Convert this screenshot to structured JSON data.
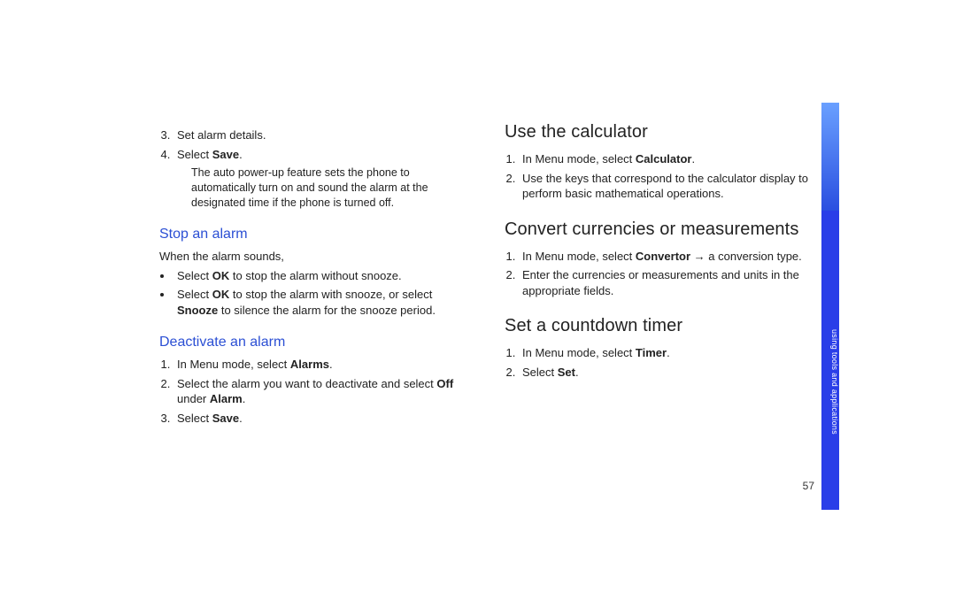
{
  "left": {
    "ol_top": {
      "start": 3,
      "i1_pre": "Set alarm details.",
      "i2_pre": "Select ",
      "i2_bold": "Save",
      "i2_post": "."
    },
    "note": "The auto power-up feature sets the phone to automatically turn on and sound the alarm at the designated time if the phone is turned off.",
    "h2a": "Stop an alarm",
    "para1": "When the alarm sounds,",
    "ul": {
      "i1_pre": "Select ",
      "i1_b1": "OK",
      "i1_post": " to stop the alarm without snooze.",
      "i2_pre": "Select ",
      "i2_b1": "OK",
      "i2_mid": " to stop the alarm with snooze, or select ",
      "i2_b2": "Snooze",
      "i2_post": " to silence the alarm for the snooze period."
    },
    "h2b": "Deactivate an alarm",
    "ol_b": {
      "i1_pre": "In Menu mode, select ",
      "i1_b": "Alarms",
      "i1_post": ".",
      "i2_pre": "Select the alarm you want to deactivate and select ",
      "i2_b1": "Off",
      "i2_mid": " under ",
      "i2_b2": "Alarm",
      "i2_post": ".",
      "i3_pre": "Select ",
      "i3_b": "Save",
      "i3_post": "."
    }
  },
  "right": {
    "h1a": "Use the calculator",
    "ol_a": {
      "i1_pre": "In Menu mode, select ",
      "i1_b": "Calculator",
      "i1_post": ".",
      "i2": "Use the keys that correspond to the calculator display to perform basic mathematical operations."
    },
    "h1b": "Convert currencies or measurements",
    "ol_b": {
      "i1_pre": "In Menu mode, select ",
      "i1_b": "Convertor",
      "i1_arrow": " → ",
      "i1_post": "a conversion type.",
      "i2": "Enter the currencies or measurements and units in the appropriate fields."
    },
    "h1c": "Set a countdown timer",
    "ol_c": {
      "i1_pre": "In Menu mode, select ",
      "i1_b": "Timer",
      "i1_post": ".",
      "i2_pre": "Select ",
      "i2_b": "Set",
      "i2_post": "."
    }
  },
  "pagenum": "57",
  "sidetab": "using tools and applications"
}
